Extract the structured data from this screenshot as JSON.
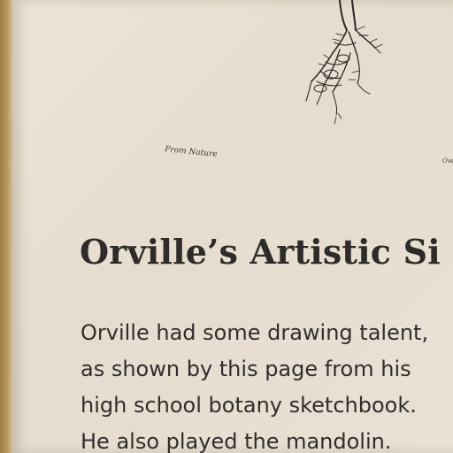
{
  "sketch_caption": "From Nature",
  "sketch_caption_right": "Over",
  "heading": "Orville’s Artistic Si",
  "body_lines": [
    "Orville had some drawing talent,",
    "as shown by this page from his",
    "high school botany sketchbook.",
    "He also played the mandolin."
  ],
  "colors": {
    "panel": "#e8e0d3",
    "frame": "#b89a5f",
    "text": "#2e2c2a"
  }
}
